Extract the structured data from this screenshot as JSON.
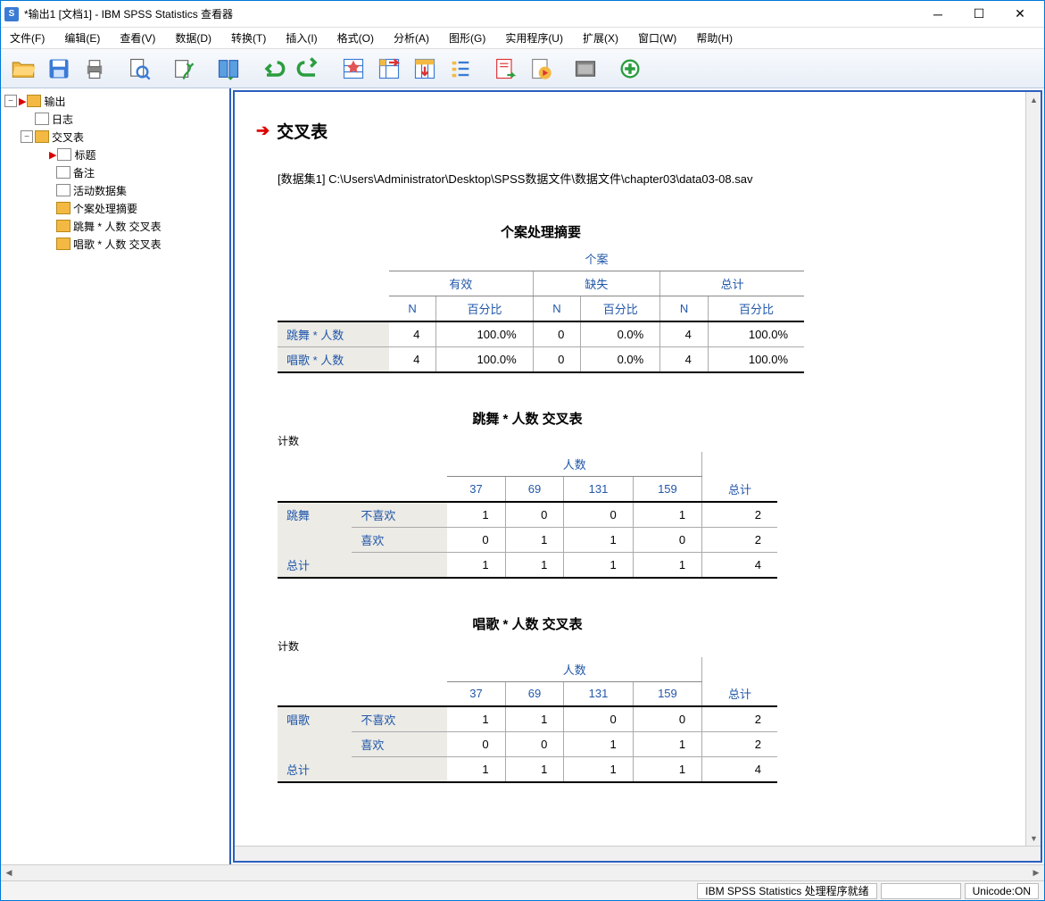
{
  "window": {
    "title": "*输出1 [文档1] - IBM SPSS Statistics 查看器"
  },
  "menubar": {
    "file": "文件(F)",
    "edit": "编辑(E)",
    "view": "查看(V)",
    "data": "数据(D)",
    "transform": "转换(T)",
    "insert": "插入(I)",
    "format": "格式(O)",
    "analyze": "分析(A)",
    "graphs": "图形(G)",
    "utilities": "实用程序(U)",
    "extensions": "扩展(X)",
    "wnd": "窗口(W)",
    "help": "帮助(H)"
  },
  "tree": {
    "root": "输出",
    "log": "日志",
    "crosstab": "交叉表",
    "title": "标题",
    "notes": "备注",
    "dataset": "活动数据集",
    "summary": "个案处理摘要",
    "ct1": "跳舞 * 人数 交叉表",
    "ct2": "唱歌 * 人数 交叉表"
  },
  "output": {
    "heading": "交叉表",
    "dataset_line": "[数据集1] C:\\Users\\Administrator\\Desktop\\SPSS数据文件\\数据文件\\chapter03\\data03-08.sav",
    "summary": {
      "title": "个案处理摘要",
      "super": "个案",
      "cols": {
        "valid": "有效",
        "missing": "缺失",
        "total": "总计",
        "n": "N",
        "pct": "百分比"
      },
      "rows": [
        {
          "label": "跳舞 * 人数",
          "valid_n": "4",
          "valid_pct": "100.0%",
          "miss_n": "0",
          "miss_pct": "0.0%",
          "tot_n": "4",
          "tot_pct": "100.0%"
        },
        {
          "label": "唱歌 * 人数",
          "valid_n": "4",
          "valid_pct": "100.0%",
          "miss_n": "0",
          "miss_pct": "0.0%",
          "tot_n": "4",
          "tot_pct": "100.0%"
        }
      ]
    },
    "ct1": {
      "title": "跳舞 * 人数 交叉表",
      "count": "计数",
      "super": "人数",
      "cols": [
        "37",
        "69",
        "131",
        "159"
      ],
      "total_col": "总计",
      "row_label": "跳舞",
      "rows": [
        {
          "label": "不喜欢",
          "vals": [
            "1",
            "0",
            "0",
            "1"
          ],
          "tot": "2"
        },
        {
          "label": "喜欢",
          "vals": [
            "0",
            "1",
            "1",
            "0"
          ],
          "tot": "2"
        }
      ],
      "total_row": {
        "label": "总计",
        "vals": [
          "1",
          "1",
          "1",
          "1"
        ],
        "tot": "4"
      }
    },
    "ct2": {
      "title": "唱歌 * 人数 交叉表",
      "count": "计数",
      "super": "人数",
      "cols": [
        "37",
        "69",
        "131",
        "159"
      ],
      "total_col": "总计",
      "row_label": "唱歌",
      "rows": [
        {
          "label": "不喜欢",
          "vals": [
            "1",
            "1",
            "0",
            "0"
          ],
          "tot": "2"
        },
        {
          "label": "喜欢",
          "vals": [
            "0",
            "0",
            "1",
            "1"
          ],
          "tot": "2"
        }
      ],
      "total_row": {
        "label": "总计",
        "vals": [
          "1",
          "1",
          "1",
          "1"
        ],
        "tot": "4"
      }
    }
  },
  "status": {
    "ready": "IBM SPSS Statistics 处理程序就绪",
    "unicode": "Unicode:ON"
  }
}
